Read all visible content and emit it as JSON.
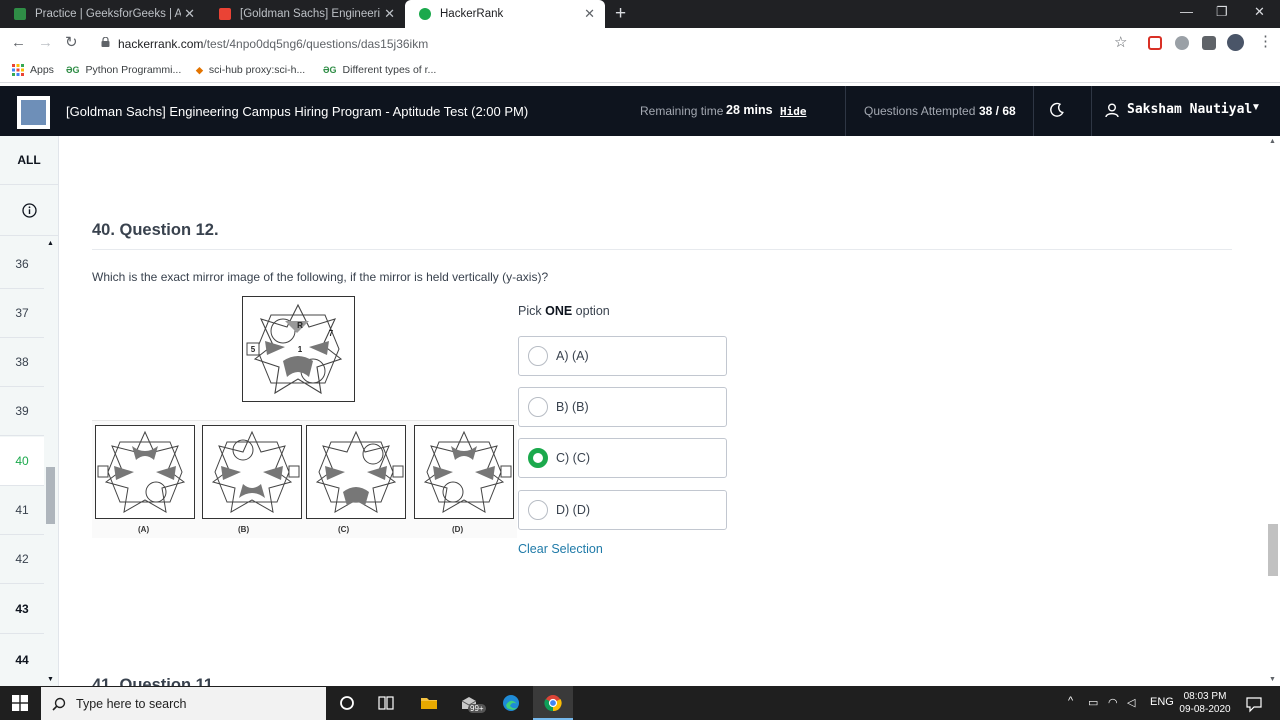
{
  "browser": {
    "tabs": [
      {
        "title": "Practice | GeeksforGeeks | A comp",
        "favicon": "gfg-icon",
        "active": false
      },
      {
        "title": "[Goldman Sachs] Engineering Ca",
        "favicon": "gmail-icon",
        "active": false
      },
      {
        "title": "HackerRank",
        "favicon": "hackerrank-icon",
        "active": true
      }
    ],
    "url_host": "hackerrank.com",
    "url_path": "/test/4npo0dq5ng6/questions/das15j36ikm",
    "bookmarks": [
      {
        "label": "Apps",
        "icon": "apps-grid-icon"
      },
      {
        "label": "Python Programmi...",
        "icon": "gfg-icon"
      },
      {
        "label": "sci-hub proxy:sci-h...",
        "icon": "scihub-icon"
      },
      {
        "label": "Different types of r...",
        "icon": "gfg-icon"
      }
    ],
    "bookmark_icon_text": "ƏG"
  },
  "header": {
    "test_title": "[Goldman Sachs] Engineering Campus Hiring Program - Aptitude Test (2:00 PM)",
    "remaining_label": "Remaining time",
    "remaining_value": "28 mins",
    "hide_label": "Hide",
    "attempted_label": "Questions Attempted",
    "attempted_value": "38 / 68",
    "user_name": "Saksham Nautiyal"
  },
  "sidebar": {
    "all_label": "ALL",
    "questions": [
      {
        "num": "36",
        "bold": false,
        "current": false
      },
      {
        "num": "37",
        "bold": false,
        "current": false
      },
      {
        "num": "38",
        "bold": false,
        "current": false
      },
      {
        "num": "39",
        "bold": false,
        "current": false
      },
      {
        "num": "40",
        "bold": false,
        "current": true
      },
      {
        "num": "41",
        "bold": false,
        "current": false
      },
      {
        "num": "42",
        "bold": false,
        "current": false
      },
      {
        "num": "43",
        "bold": true,
        "current": false
      },
      {
        "num": "44",
        "bold": true,
        "current": false
      }
    ]
  },
  "question": {
    "heading": "40. Question 12.",
    "text": "Which is the exact mirror image of the following, if the mirror is held vertically (y-axis)?",
    "figure_option_labels": [
      "(A)",
      "(B)",
      "(C)",
      "(D)"
    ],
    "figure_top_letters": [
      "R",
      "5",
      "1",
      "7"
    ],
    "pick_prefix": "Pick ",
    "pick_bold": "ONE",
    "pick_suffix": " option",
    "options": [
      {
        "label": "A) (A)",
        "selected": false
      },
      {
        "label": "B) (B)",
        "selected": false
      },
      {
        "label": "C) (C)",
        "selected": true
      },
      {
        "label": "D) (D)",
        "selected": false
      }
    ],
    "clear_label": "Clear Selection"
  },
  "next_question_heading": "41. Question 11.",
  "taskbar": {
    "search_placeholder": "Type here to search",
    "mail_badge": "99+",
    "language": "ENG",
    "time": "08:03 PM",
    "date": "09-08-2020"
  },
  "colors": {
    "brand_green": "#1ba94c",
    "header_bg": "#0e141e",
    "link_blue": "#1f7aa8"
  }
}
